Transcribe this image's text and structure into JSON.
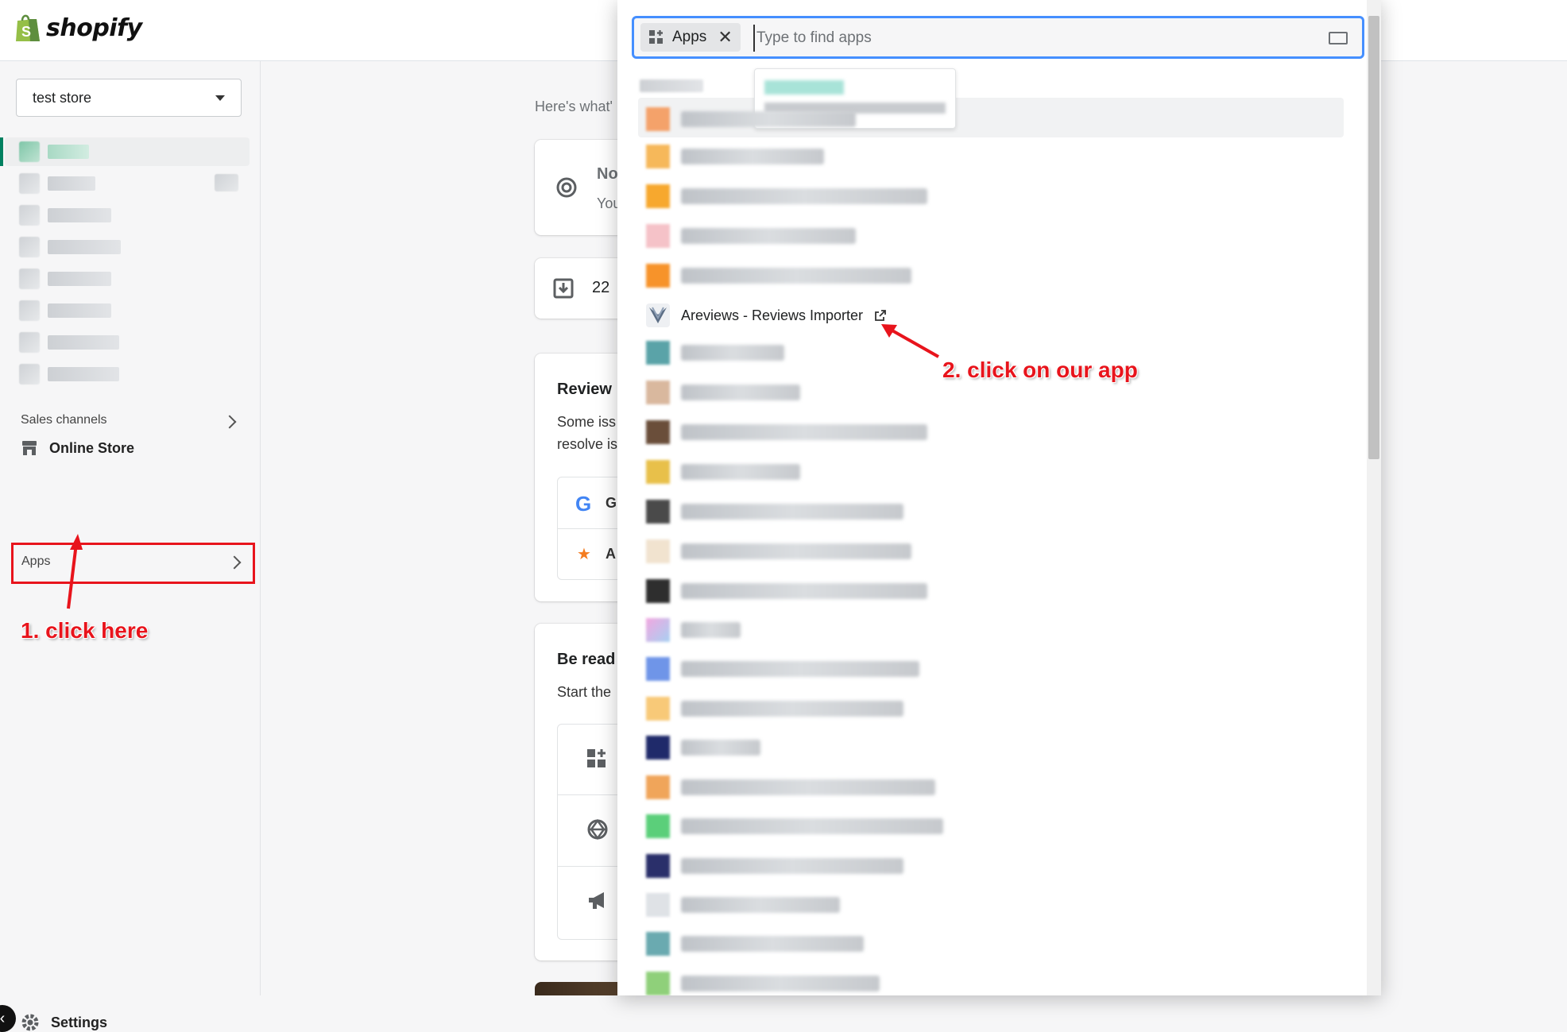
{
  "brand": {
    "name": "shopify"
  },
  "sidebar": {
    "store_name": "test store",
    "sales_channels_label": "Sales channels",
    "online_store_label": "Online Store",
    "apps_label": "Apps",
    "settings_label": "Settings"
  },
  "main": {
    "heading_hint": "Here's what'",
    "card1_title": "No",
    "card1_sub": "You",
    "card2_count": "22",
    "review_title": "Review",
    "review_text_1": "Some iss",
    "review_text_2": "resolve is",
    "review_item_g": "G",
    "review_item_a": "A",
    "ready_title": "Be read",
    "ready_text": "Start the"
  },
  "search": {
    "chip_label": "Apps",
    "placeholder": "Type to find apps",
    "value": ""
  },
  "app_list": {
    "visible_app_name": "Areviews - Reviews Importer"
  },
  "annotations": {
    "step1": "1. click here",
    "step2": "2. click on our app"
  },
  "colors": {
    "accent_green": "#008060",
    "annotation_red": "#e8141c",
    "focus_blue": "#458fff"
  }
}
